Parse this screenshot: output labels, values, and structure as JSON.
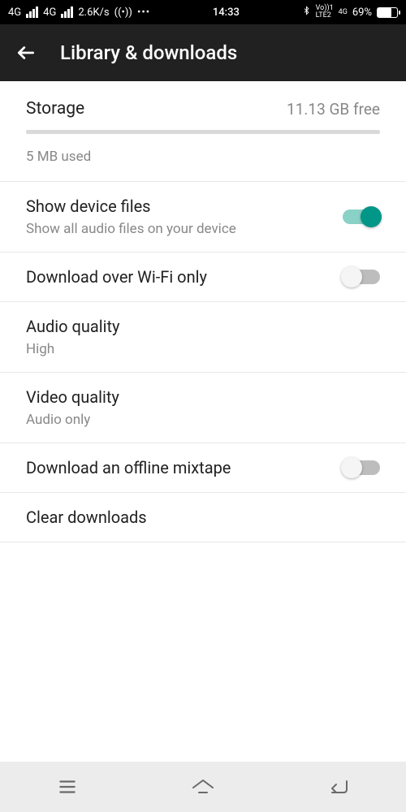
{
  "status": {
    "net_left_1": "4G",
    "net_left_2": "4G",
    "speed": "2.6K/s",
    "time": "14:33",
    "volte": "Vo))1\nLTE2",
    "net_right": "4G",
    "battery_pct": "69%"
  },
  "header": {
    "title": "Library & downloads"
  },
  "storage": {
    "title": "Storage",
    "free": "11.13 GB free",
    "used": "5 MB used"
  },
  "settings": {
    "show_device_files": {
      "title": "Show device files",
      "sub": "Show all audio files on your device",
      "on": true
    },
    "wifi_only": {
      "title": "Download over Wi-Fi only",
      "on": false
    },
    "audio_quality": {
      "title": "Audio quality",
      "sub": "High"
    },
    "video_quality": {
      "title": "Video quality",
      "sub": "Audio only"
    },
    "offline_mixtape": {
      "title": "Download an offline mixtape",
      "on": false
    },
    "clear_downloads": {
      "title": "Clear downloads"
    }
  }
}
